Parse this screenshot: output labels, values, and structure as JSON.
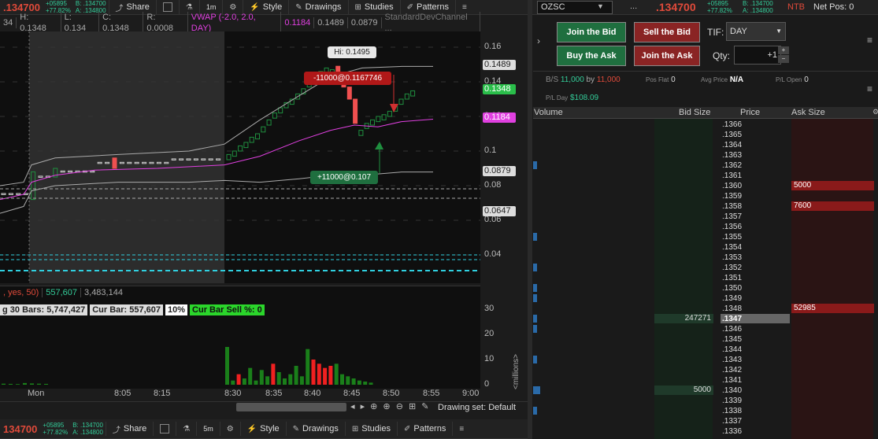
{
  "top_toolbar": {
    "price": ".134700",
    "change": "+05895",
    "change_pct": "+77.82%",
    "bid": "B: .134700",
    "ask": "A: .134800",
    "share": "Share",
    "timeframe": "1m",
    "style": "Style",
    "drawings": "Drawings",
    "studies": "Studies",
    "patterns": "Patterns"
  },
  "bottom_toolbar": {
    "price": "134700",
    "change": "+05895",
    "change_pct": "+77.82%",
    "bid": "B: .134700",
    "ask": "A: .134800",
    "share": "Share",
    "timeframe": "5m",
    "style": "Style",
    "drawings": "Drawings",
    "studies": "Studies",
    "patterns": "Patterns"
  },
  "study_bar": {
    "high": "H: 0.1348",
    "low": "L: 0.134",
    "close": "C: 0.1348",
    "range": "R: 0.0008",
    "vwap": "VWAP (-2.0, 2.0, DAY)",
    "v1": "0.1184",
    "v2": "0.1489",
    "v3": "0.0879",
    "sdc": "StandardDevChannel ...",
    "left_trunc": "34"
  },
  "price_axis": {
    "ticks": [
      "0.16",
      "0.14",
      "0.12",
      "0.1",
      "0.08",
      "0.06",
      "0.04"
    ],
    "box_upper": "0.1489",
    "box_last": "0.1348",
    "box_vwap": "0.1184",
    "box_lower": "0.0879",
    "box_min": "0.0647"
  },
  "annotations": {
    "hi": "Hi: 0.1495",
    "sell": "-11000@0.1167746",
    "buy": "+11000@0.107"
  },
  "volume_panel": {
    "header_trunc": ", yes, 50)",
    "v1": "557,607",
    "v2": "3,483,144",
    "avg30": "g 30 Bars: 5,747,427",
    "curbar": "Cur Bar: 557,607",
    "pct": "10%",
    "sellpct": "Cur Bar Sell %: 0",
    "y_ticks": [
      "30",
      "20",
      "10",
      "0"
    ],
    "unit": "<millions>"
  },
  "time_axis": {
    "labels": [
      "Mon",
      "8:05",
      "8:15",
      "8:30",
      "8:35",
      "8:40",
      "8:45",
      "8:50",
      "8:55",
      "9:00"
    ]
  },
  "bottom_status": {
    "drawing_set": "Drawing set: Default"
  },
  "order_panel": {
    "symbol": "OZSC",
    "dots": "...",
    "price": ".134700",
    "change": "+05895",
    "change_pct": "+77.82%",
    "bid": "B: .134700",
    "ask": "A: .134800",
    "ntb": "NTB",
    "net_pos": "Net Pos: 0",
    "join_bid": "Join the Bid",
    "sell_bid": "Sell the Bid",
    "buy_ask": "Buy the Ask",
    "join_ask": "Join the Ask",
    "tif_label": "TIF:",
    "tif_value": "DAY",
    "qty_label": "Qty:",
    "qty_value": "+1",
    "bs_label": "B/S",
    "bs_bid": "11,000",
    "bs_by": "by",
    "bs_ask": "11,000",
    "pos_flat": "Pos Flat",
    "pos_flat_val": "0",
    "avg_price": "Avg Price",
    "avg_price_val": "N/A",
    "pl_open": "P/L Open",
    "pl_open_val": "0",
    "pl_day": "P/L Day",
    "pl_day_val": "$108.09"
  },
  "ladder": {
    "headers": [
      "Volume",
      "Bid Size",
      "Price",
      "Ask Size"
    ],
    "prices": [
      ".1366",
      ".1365",
      ".1364",
      ".1363",
      ".1362",
      ".1361",
      ".1360",
      ".1359",
      ".1358",
      ".1357",
      ".1356",
      ".1355",
      ".1354",
      ".1353",
      ".1352",
      ".1351",
      ".1350",
      ".1349",
      ".1348",
      ".1347",
      ".1346",
      ".1345",
      ".1344",
      ".1343",
      ".1342",
      ".1341",
      ".1340",
      ".1339",
      ".1338",
      ".1337",
      ".1336"
    ],
    "ask_sizes": [
      {
        "price": ".1360",
        "size": "5000"
      },
      {
        "price": ".1358",
        "size": "7600"
      },
      {
        "price": ".1348",
        "size": "52985"
      }
    ],
    "bid_sizes": [
      {
        "price": ".1347",
        "size": "247271"
      },
      {
        "price": ".1340",
        "size": "5000"
      }
    ],
    "current": ".1347"
  },
  "chart_data": {
    "type": "candlestick",
    "title": "",
    "xlabel": "",
    "ylabel": "",
    "y_range": [
      0.03,
      0.17
    ],
    "candles_sampled": [
      {
        "t": "8:30",
        "o": 0.1,
        "c": 0.102
      },
      {
        "t": "8:33",
        "o": 0.105,
        "c": 0.11
      },
      {
        "t": "8:36",
        "o": 0.118,
        "c": 0.124
      },
      {
        "t": "8:39",
        "o": 0.13,
        "c": 0.14
      },
      {
        "t": "8:42",
        "o": 0.145,
        "c": 0.148
      },
      {
        "t": "8:45",
        "o": 0.14,
        "c": 0.13
      },
      {
        "t": "8:47",
        "o": 0.12,
        "c": 0.108
      },
      {
        "t": "8:50",
        "o": 0.117,
        "c": 0.121
      },
      {
        "t": "8:55",
        "o": 0.133,
        "c": 0.1348
      }
    ],
    "vwap_level": 0.1184,
    "upper_band": 0.1489,
    "lower_band": 0.0879,
    "volume_millions_sampled": [
      0.5,
      1,
      0.8,
      18,
      5,
      8,
      7,
      10,
      3,
      5,
      9,
      17,
      9,
      10,
      4,
      3,
      2,
      1
    ]
  },
  "colors": {
    "up": "#1f8f3f",
    "down": "#f05050",
    "vwap": "#e040e0",
    "cyan": "#30d0e0",
    "ask_bg": "#8a1a1a",
    "bid_bg": "#1f3a2a"
  }
}
